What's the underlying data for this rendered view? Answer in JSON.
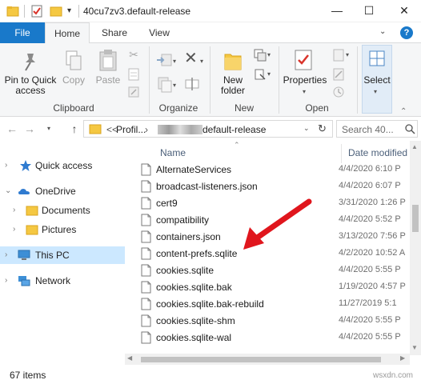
{
  "window": {
    "title": "40cu7zv3.default-release",
    "controls": {
      "minimize": "—",
      "maximize": "☐",
      "close": "✕"
    }
  },
  "ribbon_tabs": {
    "file": "File",
    "home": "Home",
    "share": "Share",
    "view": "View",
    "help": "?"
  },
  "ribbon": {
    "pin_to_quick_access": "Pin to Quick access",
    "copy": "Copy",
    "paste": "Paste",
    "clipboard_group": "Clipboard",
    "organize_group": "Organize",
    "new_folder": "New folder",
    "new_group": "New",
    "properties": "Properties",
    "open_group": "Open",
    "select": "Select"
  },
  "address": {
    "overflow": "<<",
    "crumb_profiles": "Profil...",
    "crumb_current": "default-release",
    "search_placeholder": "Search 40..."
  },
  "nav_pane": {
    "items": [
      {
        "label": "Quick access",
        "icon": "star-icon"
      },
      {
        "label": "OneDrive",
        "icon": "cloud-icon"
      },
      {
        "label": "Documents",
        "icon": "folder-icon"
      },
      {
        "label": "Pictures",
        "icon": "folder-icon"
      },
      {
        "label": "This PC",
        "icon": "computer-icon"
      },
      {
        "label": "Network",
        "icon": "network-icon"
      }
    ]
  },
  "file_list": {
    "col_name": "Name",
    "col_date": "Date modified",
    "files": [
      {
        "name": "AlternateServices",
        "date": "4/4/2020 6:10 P"
      },
      {
        "name": "broadcast-listeners.json",
        "date": "4/4/2020 6:07 P"
      },
      {
        "name": "cert9",
        "date": "3/31/2020 1:26 P"
      },
      {
        "name": "compatibility",
        "date": "4/4/2020 5:52 P"
      },
      {
        "name": "containers.json",
        "date": "3/13/2020 7:56 P"
      },
      {
        "name": "content-prefs.sqlite",
        "date": "4/2/2020 10:52 A"
      },
      {
        "name": "cookies.sqlite",
        "date": "4/4/2020 5:55 P"
      },
      {
        "name": "cookies.sqlite.bak",
        "date": "1/19/2020 4:57 P"
      },
      {
        "name": "cookies.sqlite.bak-rebuild",
        "date": "11/27/2019 5:1"
      },
      {
        "name": "cookies.sqlite-shm",
        "date": "4/4/2020 5:55 P"
      },
      {
        "name": "cookies.sqlite-wal",
        "date": "4/4/2020 5:55 P"
      }
    ]
  },
  "status": {
    "count": "67 items",
    "watermark": "wsxdn.com"
  },
  "colors": {
    "accent": "#1979ca",
    "selection": "#cce8ff",
    "arrow": "#e0161d"
  }
}
